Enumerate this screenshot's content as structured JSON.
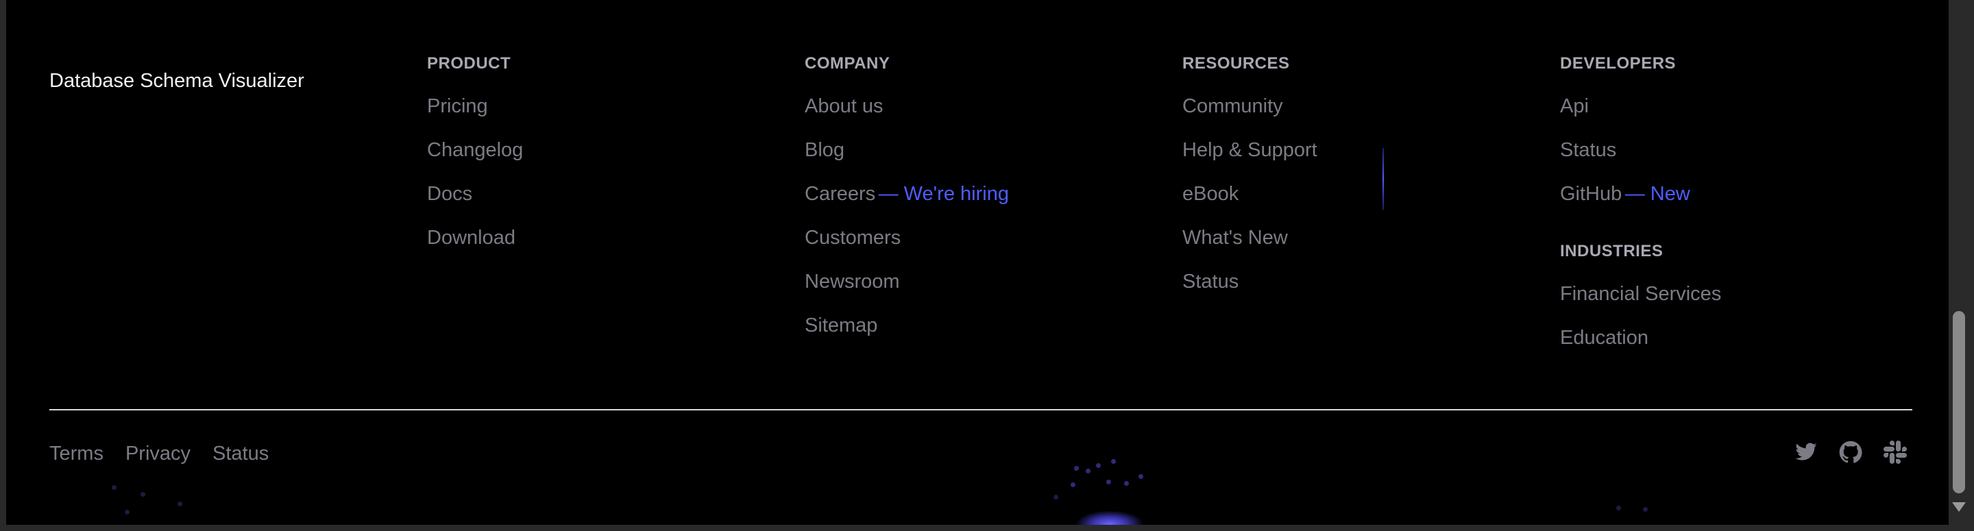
{
  "footer": {
    "brand": "Database Schema Visualizer",
    "columns": [
      {
        "heading": "PRODUCT",
        "links": [
          {
            "label": "Pricing"
          },
          {
            "label": "Changelog"
          },
          {
            "label": "Docs"
          },
          {
            "label": "Download"
          }
        ]
      },
      {
        "heading": "COMPANY",
        "links": [
          {
            "label": "About us"
          },
          {
            "label": "Blog"
          },
          {
            "label": "Careers",
            "badge": "— We're hiring"
          },
          {
            "label": "Customers"
          },
          {
            "label": "Newsroom"
          },
          {
            "label": "Sitemap"
          }
        ]
      },
      {
        "heading": "RESOURCES",
        "links": [
          {
            "label": "Community"
          },
          {
            "label": "Help & Support"
          },
          {
            "label": "eBook"
          },
          {
            "label": "What's New"
          },
          {
            "label": "Status"
          }
        ]
      },
      {
        "heading": "DEVELOPERS",
        "links": [
          {
            "label": "Api"
          },
          {
            "label": "Status"
          },
          {
            "label": "GitHub",
            "badge": "— New"
          }
        ],
        "subsection": {
          "heading": "INDUSTRIES",
          "links": [
            {
              "label": "Financial Services"
            },
            {
              "label": "Education"
            }
          ]
        }
      }
    ],
    "legal_links": [
      {
        "label": "Terms"
      },
      {
        "label": "Privacy"
      },
      {
        "label": "Status"
      }
    ],
    "social_icons": [
      "twitter-icon",
      "github-icon",
      "slack-icon"
    ],
    "colors": {
      "background": "#000000",
      "brand_text": "#f2f2f2",
      "heading_text": "#a9a9b3",
      "link_text": "#7c7c86",
      "accent": "#4e5dff",
      "divider": "#d8d8d8"
    }
  }
}
